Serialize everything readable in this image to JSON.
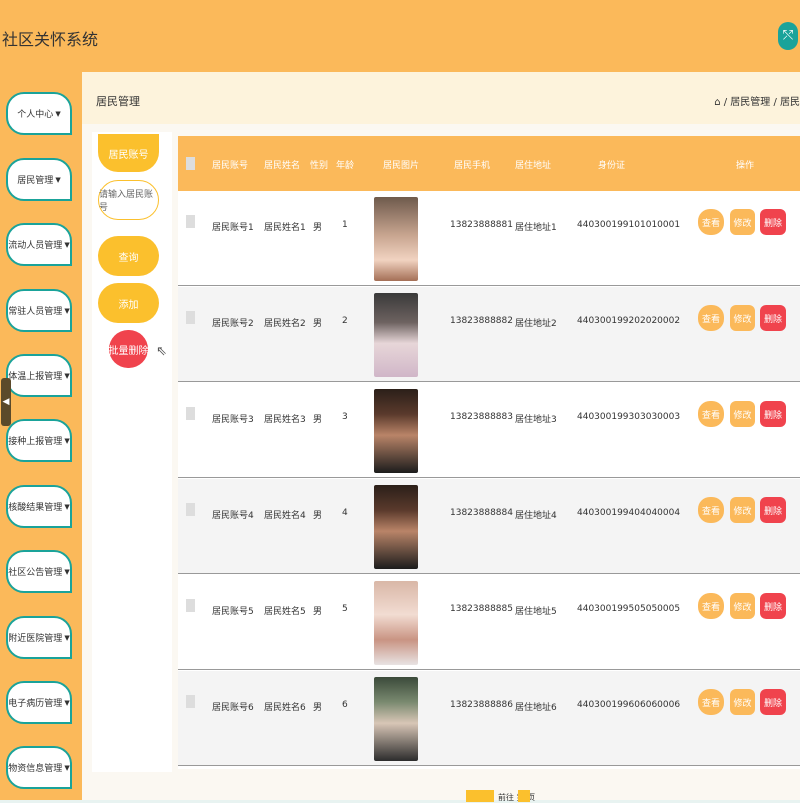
{
  "app": {
    "title": "社区关怀系统",
    "exit_icon": "⤲"
  },
  "sidebar": {
    "items": [
      {
        "label": "个人中心"
      },
      {
        "label": "居民管理"
      },
      {
        "label": "流动人员管理"
      },
      {
        "label": "常驻人员管理"
      },
      {
        "label": "体温上报管理"
      },
      {
        "label": "接种上报管理"
      },
      {
        "label": "核酸结果管理"
      },
      {
        "label": "社区公告管理"
      },
      {
        "label": "附近医院管理"
      },
      {
        "label": "电子病历管理"
      },
      {
        "label": "物资信息管理"
      }
    ],
    "toggle_icon": "◀"
  },
  "header": {
    "page_title": "居民管理",
    "breadcrumb": "⌂ / 居民管理 / 居民"
  },
  "search": {
    "field_label": "居民账号",
    "placeholder": "请输入居民账号",
    "query_label": "查询",
    "add_label": "添加",
    "batch_delete_label": "批量删除"
  },
  "table": {
    "columns": [
      "居民账号",
      "居民姓名",
      "性别",
      "年龄",
      "居民图片",
      "居民手机",
      "居住地址",
      "身份证",
      "操作"
    ],
    "actions": {
      "view": "查看",
      "edit": "修改",
      "delete": "删除"
    },
    "rows": [
      {
        "account": "居民账号1",
        "name": "居民姓名1",
        "gender": "男",
        "age": "1",
        "phone": "13823888881",
        "address": "居住地址1",
        "id_card": "440300199101010001"
      },
      {
        "account": "居民账号2",
        "name": "居民姓名2",
        "gender": "男",
        "age": "2",
        "phone": "13823888882",
        "address": "居住地址2",
        "id_card": "440300199202020002"
      },
      {
        "account": "居民账号3",
        "name": "居民姓名3",
        "gender": "男",
        "age": "3",
        "phone": "13823888883",
        "address": "居住地址3",
        "id_card": "440300199303030003"
      },
      {
        "account": "居民账号4",
        "name": "居民姓名4",
        "gender": "男",
        "age": "4",
        "phone": "13823888884",
        "address": "居住地址4",
        "id_card": "440300199404040004"
      },
      {
        "account": "居民账号5",
        "name": "居民姓名5",
        "gender": "男",
        "age": "5",
        "phone": "13823888885",
        "address": "居住地址5",
        "id_card": "440300199505050005"
      },
      {
        "account": "居民账号6",
        "name": "居民姓名6",
        "gender": "男",
        "age": "6",
        "phone": "13823888886",
        "address": "居住地址6",
        "id_card": "440300199606060006"
      }
    ]
  },
  "pagination": {
    "text": "前往 第 页"
  },
  "colors": {
    "accent": "#fbb95a",
    "teal": "#1aa39a",
    "danger": "#f0434d",
    "yellow": "#fbc02d"
  }
}
